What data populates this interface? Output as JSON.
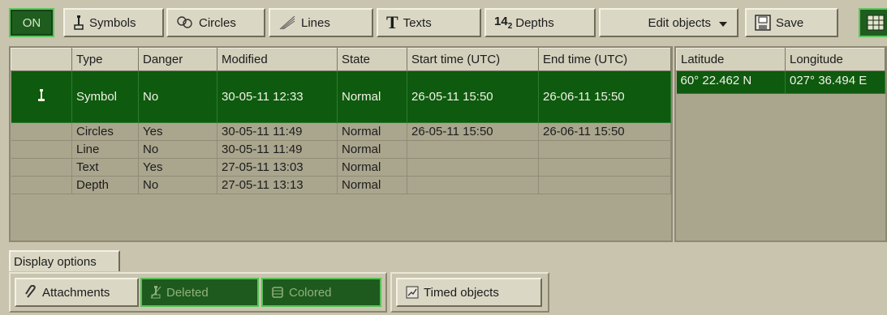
{
  "toolbar": {
    "on_label": "ON",
    "symbols_label": "Symbols",
    "circles_label": "Circles",
    "lines_label": "Lines",
    "texts_label": "Texts",
    "depths_prefix": "14",
    "depths_sub": "2",
    "depths_label": "Depths",
    "edit_objects_label": "Edit objects",
    "save_label": "Save"
  },
  "objects_table": {
    "columns": [
      "",
      "Type",
      "Danger",
      "Modified",
      "State",
      "Start time (UTC)",
      "End time (UTC)"
    ],
    "rows": [
      {
        "type": "Symbol",
        "danger": "No",
        "modified": "30-05-11 12:33",
        "state": "Normal",
        "start": "26-05-11 15:50",
        "end": "26-06-11 15:50",
        "selected": true
      },
      {
        "type": "Circles",
        "danger": "Yes",
        "modified": "30-05-11 11:49",
        "state": "Normal",
        "start": "26-05-11 15:50",
        "end": "26-06-11 15:50"
      },
      {
        "type": "Line",
        "danger": "No",
        "modified": "30-05-11 11:49",
        "state": "Normal",
        "start": "",
        "end": ""
      },
      {
        "type": "Text",
        "danger": "Yes",
        "modified": "27-05-11 13:03",
        "state": "Normal",
        "start": "",
        "end": ""
      },
      {
        "type": "Depth",
        "danger": "No",
        "modified": "27-05-11 13:13",
        "state": "Normal",
        "start": "",
        "end": ""
      }
    ]
  },
  "coords_table": {
    "columns": [
      "Latitude",
      "Longitude"
    ],
    "rows": [
      {
        "latitude": "60° 22.462 N",
        "longitude": "027° 36.494 E"
      }
    ]
  },
  "display_options": {
    "tab_label": "Display options",
    "attachments_label": "Attachments",
    "deleted_label": "Deleted",
    "colored_label": "Colored",
    "timed_objects_label": "Timed objects"
  },
  "colors": {
    "background": "#c8c4ad",
    "table_background": "#aaa68e",
    "selected_row": "#0e5a0e",
    "active_green": "#1e5d1e"
  }
}
